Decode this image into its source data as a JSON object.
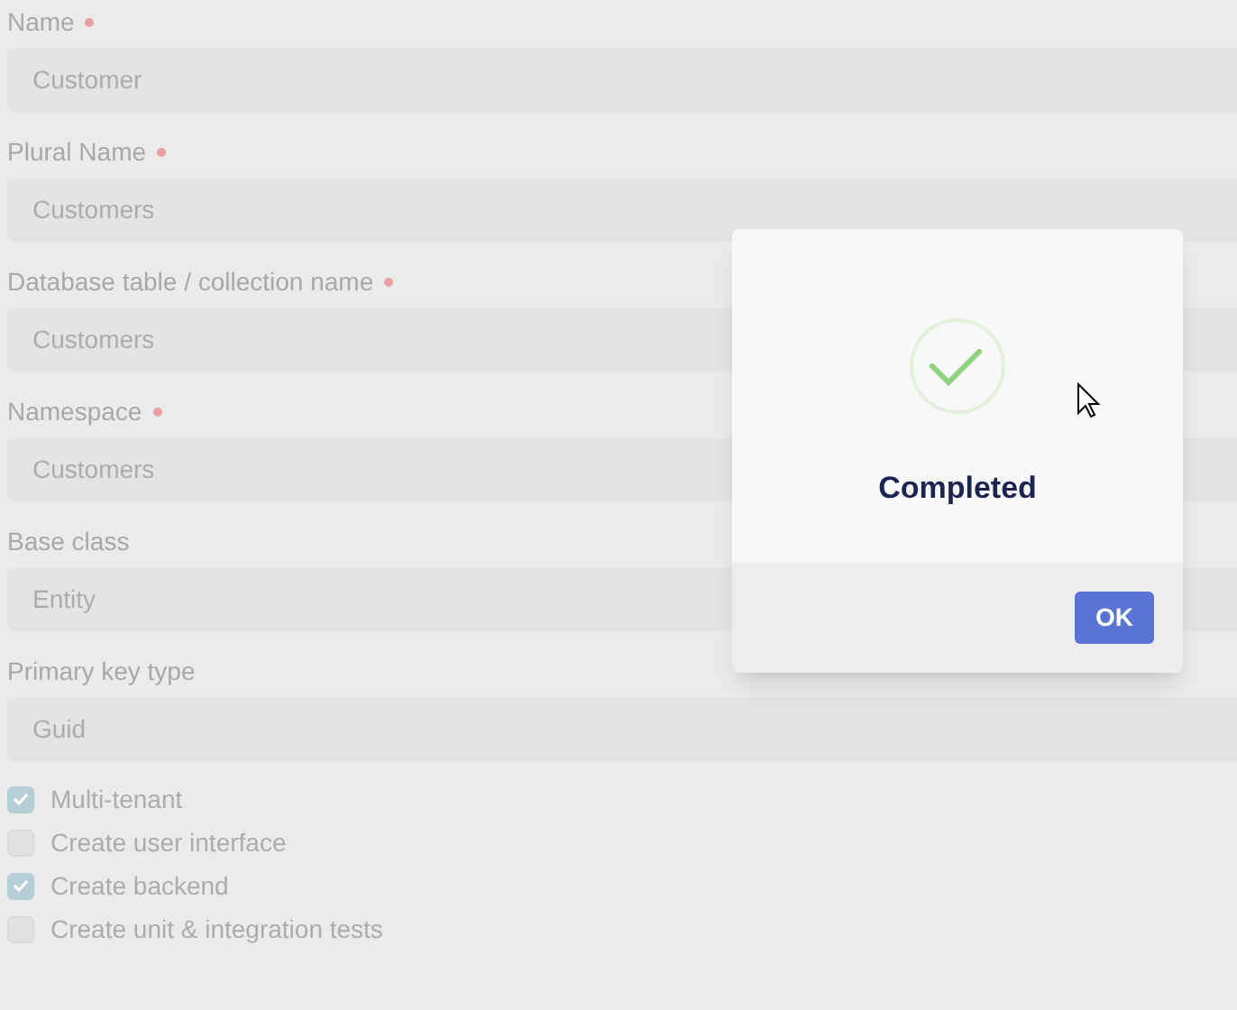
{
  "fields": [
    {
      "label": "Name",
      "required": true,
      "value": "Customer"
    },
    {
      "label": "Plural Name",
      "required": true,
      "value": "Customers"
    },
    {
      "label": "Database table / collection name",
      "required": true,
      "value": "Customers"
    },
    {
      "label": "Namespace",
      "required": true,
      "value": "Customers"
    },
    {
      "label": "Base class",
      "required": false,
      "value": "Entity"
    },
    {
      "label": "Primary key type",
      "required": false,
      "value": "Guid"
    }
  ],
  "options": [
    {
      "label": "Multi-tenant",
      "checked": true
    },
    {
      "label": "Create user interface",
      "checked": false
    },
    {
      "label": "Create backend",
      "checked": true
    },
    {
      "label": "Create unit & integration tests",
      "checked": false
    }
  ],
  "dialog": {
    "message": "Completed",
    "button": "OK"
  }
}
